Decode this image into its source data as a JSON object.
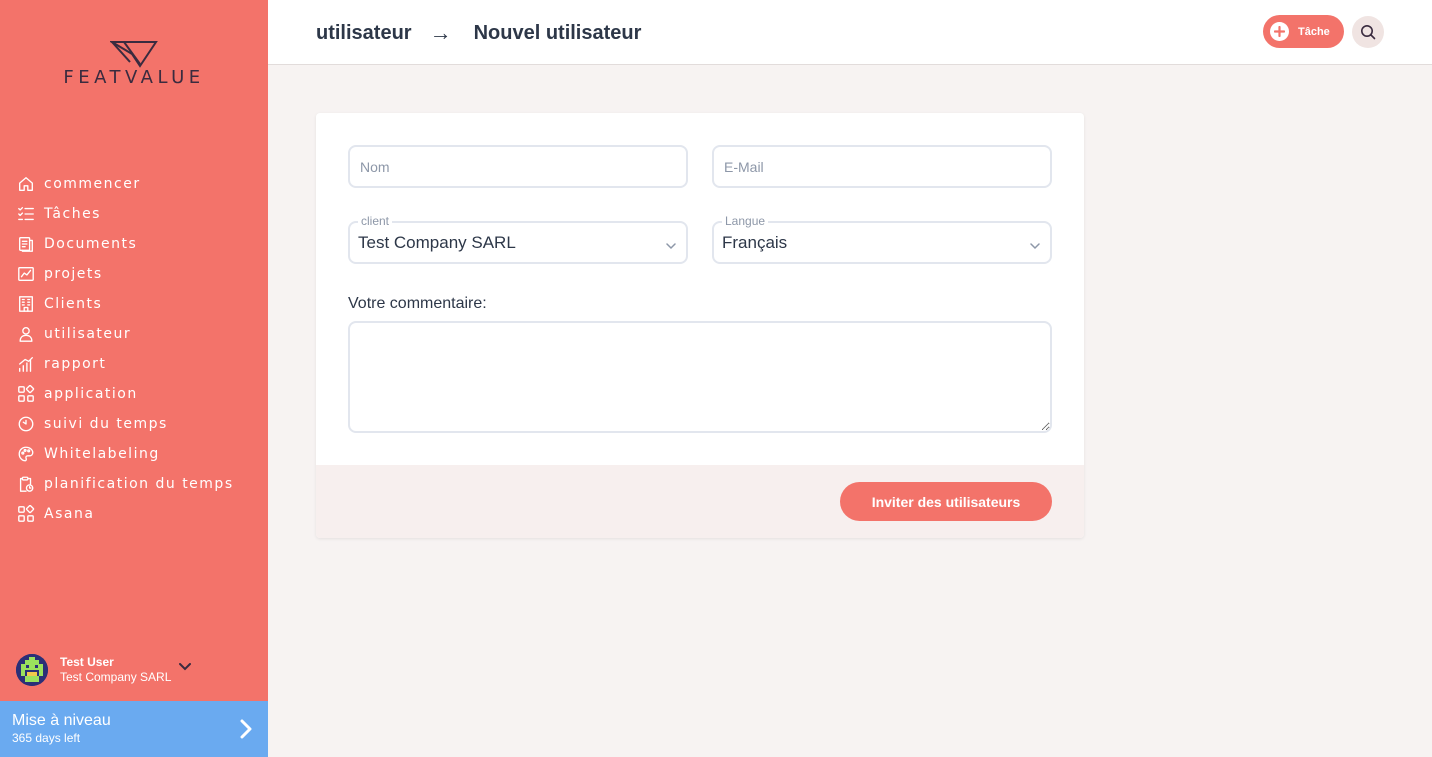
{
  "brand": {
    "name": "FEATVALUE",
    "accent": "#f3736a"
  },
  "sidebar": {
    "items": [
      {
        "label": "commencer",
        "icon": "home-icon"
      },
      {
        "label": "Tâches",
        "icon": "checklist-icon"
      },
      {
        "label": "Documents",
        "icon": "documents-icon"
      },
      {
        "label": "projets",
        "icon": "chart-board-icon"
      },
      {
        "label": "Clients",
        "icon": "building-icon"
      },
      {
        "label": "utilisateur",
        "icon": "user-icon"
      },
      {
        "label": "rapport",
        "icon": "report-bars-icon"
      },
      {
        "label": "application",
        "icon": "apps-icon"
      },
      {
        "label": "suivi du temps",
        "icon": "timer-icon"
      },
      {
        "label": "Whitelabeling",
        "icon": "palette-icon"
      },
      {
        "label": "planification du temps",
        "icon": "clipboard-clock-icon"
      },
      {
        "label": "Asana",
        "icon": "apps-icon"
      }
    ],
    "user": {
      "name": "Test User",
      "company": "Test Company SARL"
    },
    "upgrade": {
      "title": "Mise à niveau",
      "subtitle": "365 days left"
    }
  },
  "header": {
    "breadcrumb": [
      "utilisateur",
      "Nouvel utilisateur"
    ],
    "separator": "→",
    "task_button": "Tâche"
  },
  "form": {
    "name_placeholder": "Nom",
    "email_placeholder": "E-Mail",
    "client_label": "client",
    "client_value": "Test Company SARL",
    "language_label": "Langue",
    "language_value": "Français",
    "comment_label": "Votre commentaire:",
    "submit": "Inviter des utilisateurs"
  }
}
